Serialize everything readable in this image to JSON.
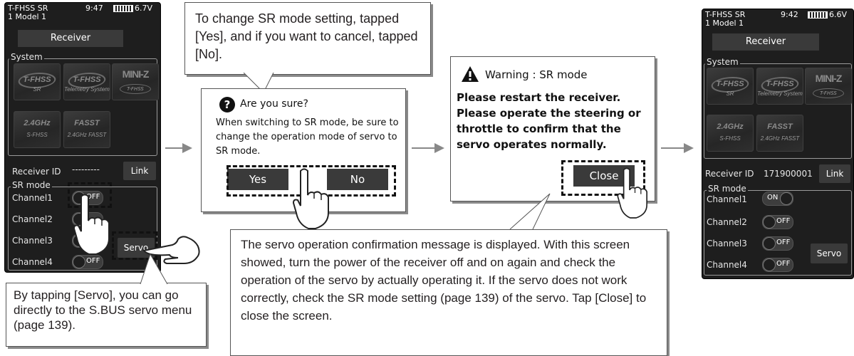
{
  "screen1": {
    "system_name": "T-FHSS SR",
    "time": "9:47",
    "voltage": "6.7V",
    "model": "1   Model 1",
    "tab": "Receiver",
    "system_label": "System",
    "logos": {
      "tfhss_sr": "T-FHSS",
      "tfhss_sr_sub": "SR",
      "tfhss": "T-FHSS",
      "tfhss_sub": "Telemetry System",
      "miniz": "MINI-Z",
      "miniz_sub": "T-FHSS",
      "s_fhss": "2.4GHz",
      "s_fhss_sub": "S-FHSS",
      "fasst": "FASST",
      "fasst_sub": "2.4GHz FASST"
    },
    "receiver_id_label": "Receiver ID",
    "receiver_id_value": "---------",
    "link": "Link",
    "sr_mode_label": "SR mode",
    "channels": [
      "Channel1",
      "Channel2",
      "Channel3",
      "Channel4"
    ],
    "toggle_off": "OFF",
    "servo": "Servo"
  },
  "callout_top": "To change SR mode setting, tapped [Yes], and if you want to cancel, tapped [No].",
  "callout_servo": "By tapping [Servo], you can go directly to the S.BUS servo menu (page 139).",
  "callout_bottom": "The servo operation confirmation message is displayed. With this screen showed, turn the power of the receiver off and on again and check the operation of the servo by actually operating it. If the servo does not work correctly, check the SR mode setting (page 139) of the servo. Tap [Close] to close the screen.",
  "dialog_confirm": {
    "title": "Are you sure?",
    "message": "When switching to SR mode, be sure to change the operation mode of servo to SR mode.",
    "yes": "Yes",
    "no": "No"
  },
  "dialog_warning": {
    "title": "Warning : SR mode",
    "message": "Please restart the receiver. Please operate the steering or throttle to confirm that the servo operates normally.",
    "close": "Close"
  },
  "screen2": {
    "system_name": "T-FHSS SR",
    "time": "9:42",
    "voltage": "6.6V",
    "model": "1   Model 1",
    "tab": "Receiver",
    "system_label": "System",
    "receiver_id_label": "Receiver ID",
    "receiver_id_value": "171900001",
    "link": "Link",
    "sr_mode_label": "SR mode",
    "channels": [
      "Channel1",
      "Channel2",
      "Channel3",
      "Channel4"
    ],
    "toggle_on": "ON",
    "toggle_off": "OFF",
    "servo": "Servo"
  },
  "colors": {
    "screen_bg": "#1e1e1e",
    "button_bg": "#3a3a3a",
    "arrow": "#888888",
    "text": "#231f20"
  }
}
